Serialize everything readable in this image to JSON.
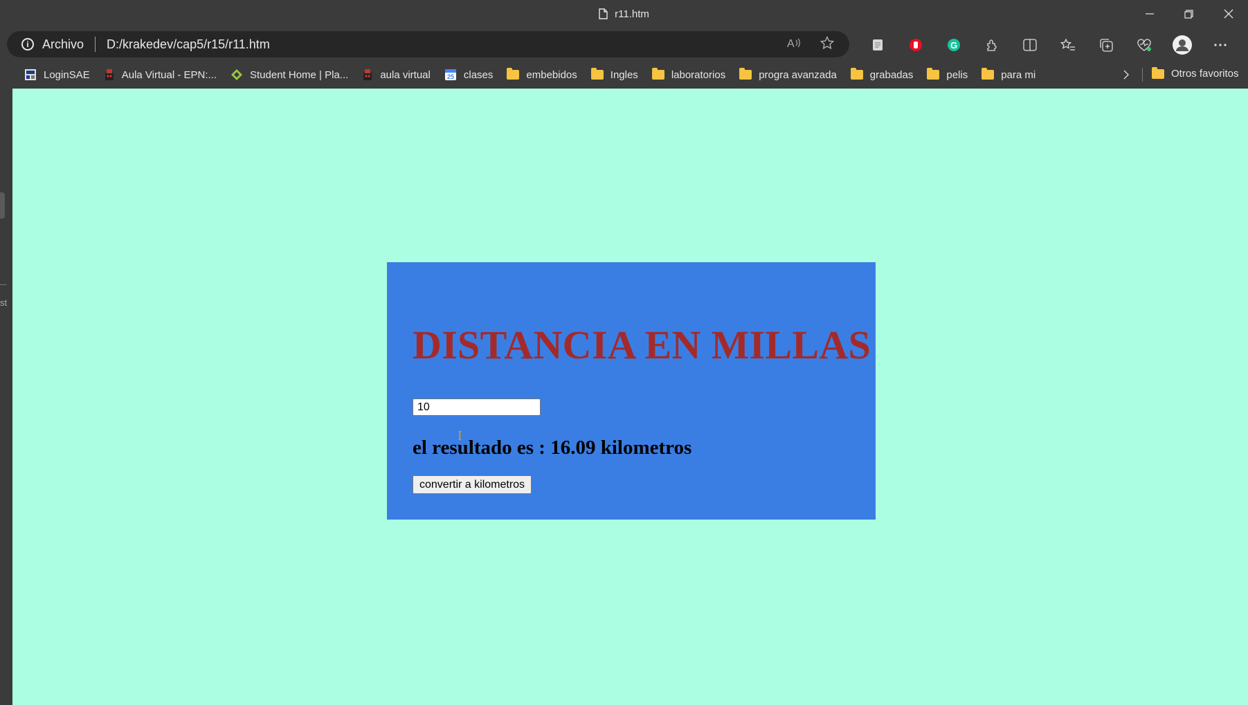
{
  "window": {
    "tab_title": "r11.htm",
    "controls": [
      "minimize",
      "restore",
      "close"
    ]
  },
  "addressbar": {
    "security_label": "Archivo",
    "url": "D:/krakedev/cap5/r15/r11.htm"
  },
  "bookmarks": [
    {
      "label": "LoginSAE",
      "icon": "loginsae-icon"
    },
    {
      "label": "Aula Virtual - EPN:...",
      "icon": "epn-icon"
    },
    {
      "label": "Student Home | Pla...",
      "icon": "platzi-icon"
    },
    {
      "label": "aula virtual",
      "icon": "epn-icon"
    },
    {
      "label": "clases",
      "icon": "calendar-icon"
    },
    {
      "label": "embebidos",
      "icon": "folder-icon"
    },
    {
      "label": "Ingles",
      "icon": "folder-icon"
    },
    {
      "label": "laboratorios",
      "icon": "folder-icon"
    },
    {
      "label": "progra avanzada",
      "icon": "folder-icon"
    },
    {
      "label": "grabadas",
      "icon": "folder-icon"
    },
    {
      "label": "pelis",
      "icon": "folder-icon"
    },
    {
      "label": "para mi",
      "icon": "folder-icon"
    }
  ],
  "other_favorites": "Otros favoritos",
  "page": {
    "heading": "DISTANCIA EN MILLAS",
    "input_value": "10",
    "result_text": "el resultado es : 16.09 kilometros",
    "button_label": "convertir a kilometros"
  },
  "colors": {
    "page_background": "#acfee2",
    "card_background": "#3a7ee3",
    "heading_color": "#a42a2a",
    "browser_chrome": "#3b3b3b"
  }
}
